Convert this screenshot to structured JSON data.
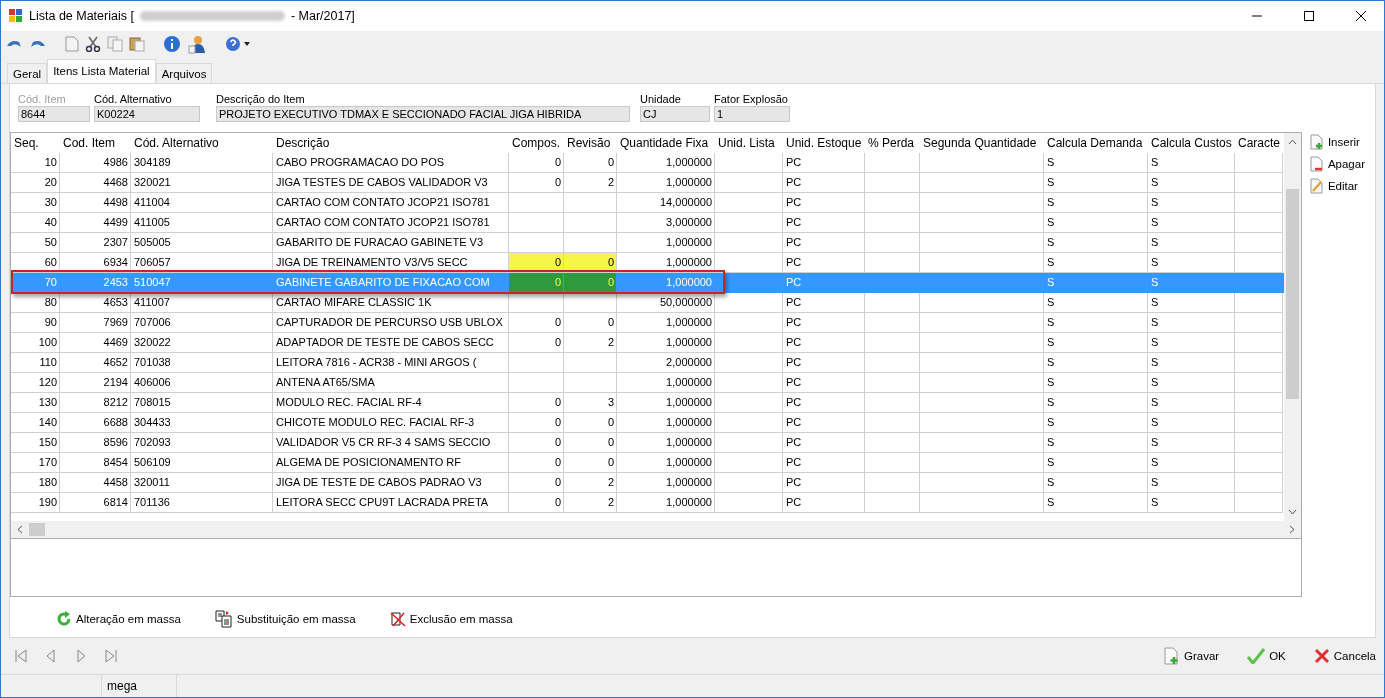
{
  "window": {
    "title_start": "Lista de Materiais [",
    "title_end": "- Mar/2017]",
    "redacted": true
  },
  "tabs": [
    {
      "label": "Geral",
      "selected": false
    },
    {
      "label": "Itens Lista Material",
      "selected": true
    },
    {
      "label": "Arquivos",
      "selected": false
    }
  ],
  "header_fields": [
    {
      "label": "Cód. Item",
      "value": "8644",
      "disabled": true
    },
    {
      "label": "Cód. Alternativo",
      "value": "K00224",
      "disabled": false
    },
    {
      "label": "Descrição do Item",
      "value": "PROJETO EXECUTIVO TDMAX E SECCIONADO FACIAL JIGA HIBRIDA",
      "disabled": false
    },
    {
      "label": "Unidade",
      "value": "CJ",
      "disabled": false
    },
    {
      "label": "Fator Explosão",
      "value": "1",
      "disabled": false
    }
  ],
  "table": {
    "columns": [
      "Seq.",
      "Cod. Item",
      "Cód. Alternativo",
      "Descrição",
      "Compos.",
      "Revisão",
      "Quantidade Fixa",
      "Unid. Lista",
      "Unid. Estoque",
      "% Perda",
      "Segunda Quantidade",
      "Calcula Demanda",
      "Calcula Custos",
      "Caracte"
    ],
    "rows": [
      {
        "seq": "10",
        "cod_item": "4986",
        "cod_alternativo": "304189",
        "descricao": "CABO PROGRAMACAO DO POS",
        "compos": "0",
        "revisao": "0",
        "quantidade_fixa": "1,000000",
        "unid_estoque": "PC",
        "calcula_demanda": "S",
        "calcula_custos": "S",
        "selected": false,
        "marked": false,
        "framed": false
      },
      {
        "seq": "20",
        "cod_item": "4468",
        "cod_alternativo": "320021",
        "descricao": "JIGA TESTES DE CABOS VALIDADOR V3",
        "compos": "0",
        "revisao": "2",
        "quantidade_fixa": "1,000000",
        "unid_estoque": "PC",
        "calcula_demanda": "S",
        "calcula_custos": "S",
        "selected": false,
        "marked": false,
        "framed": false
      },
      {
        "seq": "30",
        "cod_item": "4498",
        "cod_alternativo": "411004",
        "descricao": "CARTAO COM CONTATO JCOP21 ISO781",
        "quantidade_fixa": "14,000000",
        "unid_estoque": "PC",
        "calcula_demanda": "S",
        "calcula_custos": "S",
        "selected": false,
        "marked": false,
        "framed": false
      },
      {
        "seq": "40",
        "cod_item": "4499",
        "cod_alternativo": "411005",
        "descricao": "CARTAO COM CONTATO JCOP21 ISO781",
        "quantidade_fixa": "3,000000",
        "unid_estoque": "PC",
        "calcula_demanda": "S",
        "calcula_custos": "S",
        "selected": false,
        "marked": false,
        "framed": false
      },
      {
        "seq": "50",
        "cod_item": "2307",
        "cod_alternativo": "505005",
        "descricao": "GABARITO DE FURACAO GABINETE  V3",
        "quantidade_fixa": "1,000000",
        "unid_estoque": "PC",
        "calcula_demanda": "S",
        "calcula_custos": "S",
        "selected": false,
        "marked": false,
        "framed": false
      },
      {
        "seq": "60",
        "cod_item": "6934",
        "cod_alternativo": "706057",
        "descricao": "JIGA DE TREINAMENTO V3/V5 SECC",
        "compos": "0",
        "revisao": "0",
        "quantidade_fixa": "1,000000",
        "unid_estoque": "PC",
        "calcula_demanda": "S",
        "calcula_custos": "S",
        "selected": false,
        "marked": true,
        "framed": false
      },
      {
        "seq": "70",
        "cod_item": "2453",
        "cod_alternativo": "510047",
        "descricao": "GABINETE GABARITO DE FIXACAO COM",
        "compos": "0",
        "revisao": "0",
        "quantidade_fixa": "1,000000",
        "unid_estoque": "PC",
        "calcula_demanda": "S",
        "calcula_custos": "S",
        "selected": true,
        "marked": true,
        "framed": true
      },
      {
        "seq": "80",
        "cod_item": "4653",
        "cod_alternativo": "411007",
        "descricao": "CARTAO MIFARE CLASSIC 1K",
        "quantidade_fixa": "50,000000",
        "unid_estoque": "PC",
        "calcula_demanda": "S",
        "calcula_custos": "S",
        "selected": false,
        "marked": false,
        "framed": false
      },
      {
        "seq": "90",
        "cod_item": "7969",
        "cod_alternativo": "707006",
        "descricao": "CAPTURADOR DE PERCURSO USB UBLOX",
        "compos": "0",
        "revisao": "0",
        "quantidade_fixa": "1,000000",
        "unid_estoque": "PC",
        "calcula_demanda": "S",
        "calcula_custos": "S",
        "selected": false,
        "marked": false,
        "framed": false
      },
      {
        "seq": "100",
        "cod_item": "4469",
        "cod_alternativo": "320022",
        "descricao": "ADAPTADOR DE TESTE DE CABOS SECC",
        "compos": "0",
        "revisao": "2",
        "quantidade_fixa": "1,000000",
        "unid_estoque": "PC",
        "calcula_demanda": "S",
        "calcula_custos": "S",
        "selected": false,
        "marked": false,
        "framed": false
      },
      {
        "seq": "110",
        "cod_item": "4652",
        "cod_alternativo": "701038",
        "descricao": "LEITORA 7816 - ACR38 - MINI ARGOS  (",
        "quantidade_fixa": "2,000000",
        "unid_estoque": "PC",
        "calcula_demanda": "S",
        "calcula_custos": "S",
        "selected": false,
        "marked": false,
        "framed": false
      },
      {
        "seq": "120",
        "cod_item": "2194",
        "cod_alternativo": "406006",
        "descricao": "ANTENA AT65/SMA",
        "quantidade_fixa": "1,000000",
        "unid_estoque": "PC",
        "calcula_demanda": "S",
        "calcula_custos": "S",
        "selected": false,
        "marked": false,
        "framed": false
      },
      {
        "seq": "130",
        "cod_item": "8212",
        "cod_alternativo": "708015",
        "descricao": "MODULO REC. FACIAL RF-4",
        "compos": "0",
        "revisao": "3",
        "quantidade_fixa": "1,000000",
        "unid_estoque": "PC",
        "calcula_demanda": "S",
        "calcula_custos": "S",
        "selected": false,
        "marked": false,
        "framed": false
      },
      {
        "seq": "140",
        "cod_item": "6688",
        "cod_alternativo": "304433",
        "descricao": "CHICOTE MODULO REC. FACIAL RF-3",
        "compos": "0",
        "revisao": "0",
        "quantidade_fixa": "1,000000",
        "unid_estoque": "PC",
        "calcula_demanda": "S",
        "calcula_custos": "S",
        "selected": false,
        "marked": false,
        "framed": false
      },
      {
        "seq": "150",
        "cod_item": "8596",
        "cod_alternativo": "702093",
        "descricao": "VALIDADOR V5 CR RF-3 4 SAMS SECCIO",
        "compos": "0",
        "revisao": "0",
        "quantidade_fixa": "1,000000",
        "unid_estoque": "PC",
        "calcula_demanda": "S",
        "calcula_custos": "S",
        "selected": false,
        "marked": false,
        "framed": false
      },
      {
        "seq": "170",
        "cod_item": "8454",
        "cod_alternativo": "506109",
        "descricao": "ALGEMA DE POSICIONAMENTO RF",
        "compos": "0",
        "revisao": "0",
        "quantidade_fixa": "1,000000",
        "unid_estoque": "PC",
        "calcula_demanda": "S",
        "calcula_custos": "S",
        "selected": false,
        "marked": false,
        "framed": false
      },
      {
        "seq": "180",
        "cod_item": "4458",
        "cod_alternativo": "320011",
        "descricao": "JIGA DE TESTE DE CABOS PADRAO V3",
        "compos": "0",
        "revisao": "2",
        "quantidade_fixa": "1,000000",
        "unid_estoque": "PC",
        "calcula_demanda": "S",
        "calcula_custos": "S",
        "selected": false,
        "marked": false,
        "framed": false
      },
      {
        "seq": "190",
        "cod_item": "6814",
        "cod_alternativo": "701136",
        "descricao": "LEITORA SECC CPU9T LACRADA PRETA",
        "compos": "0",
        "revisao": "2",
        "quantidade_fixa": "1,000000",
        "unid_estoque": "PC",
        "calcula_demanda": "S",
        "calcula_custos": "S",
        "selected": false,
        "marked": false,
        "framed": false
      }
    ]
  },
  "side_buttons": [
    {
      "label": "Inserir",
      "kind": "insert"
    },
    {
      "label": "Apagar",
      "kind": "delete"
    },
    {
      "label": "Editar",
      "kind": "edit"
    }
  ],
  "mass_buttons": [
    {
      "label": "Alteração em massa",
      "kind": "refresh"
    },
    {
      "label": "Substituição em massa",
      "kind": "replace"
    },
    {
      "label": "Exclusão em massa",
      "kind": "delete"
    }
  ],
  "footer_buttons": [
    {
      "label": "Gravar",
      "kind": "save"
    },
    {
      "label": "OK",
      "kind": "ok"
    },
    {
      "label": "Cancela",
      "kind": "cancel"
    }
  ],
  "status_bar": {
    "user": "mega"
  }
}
